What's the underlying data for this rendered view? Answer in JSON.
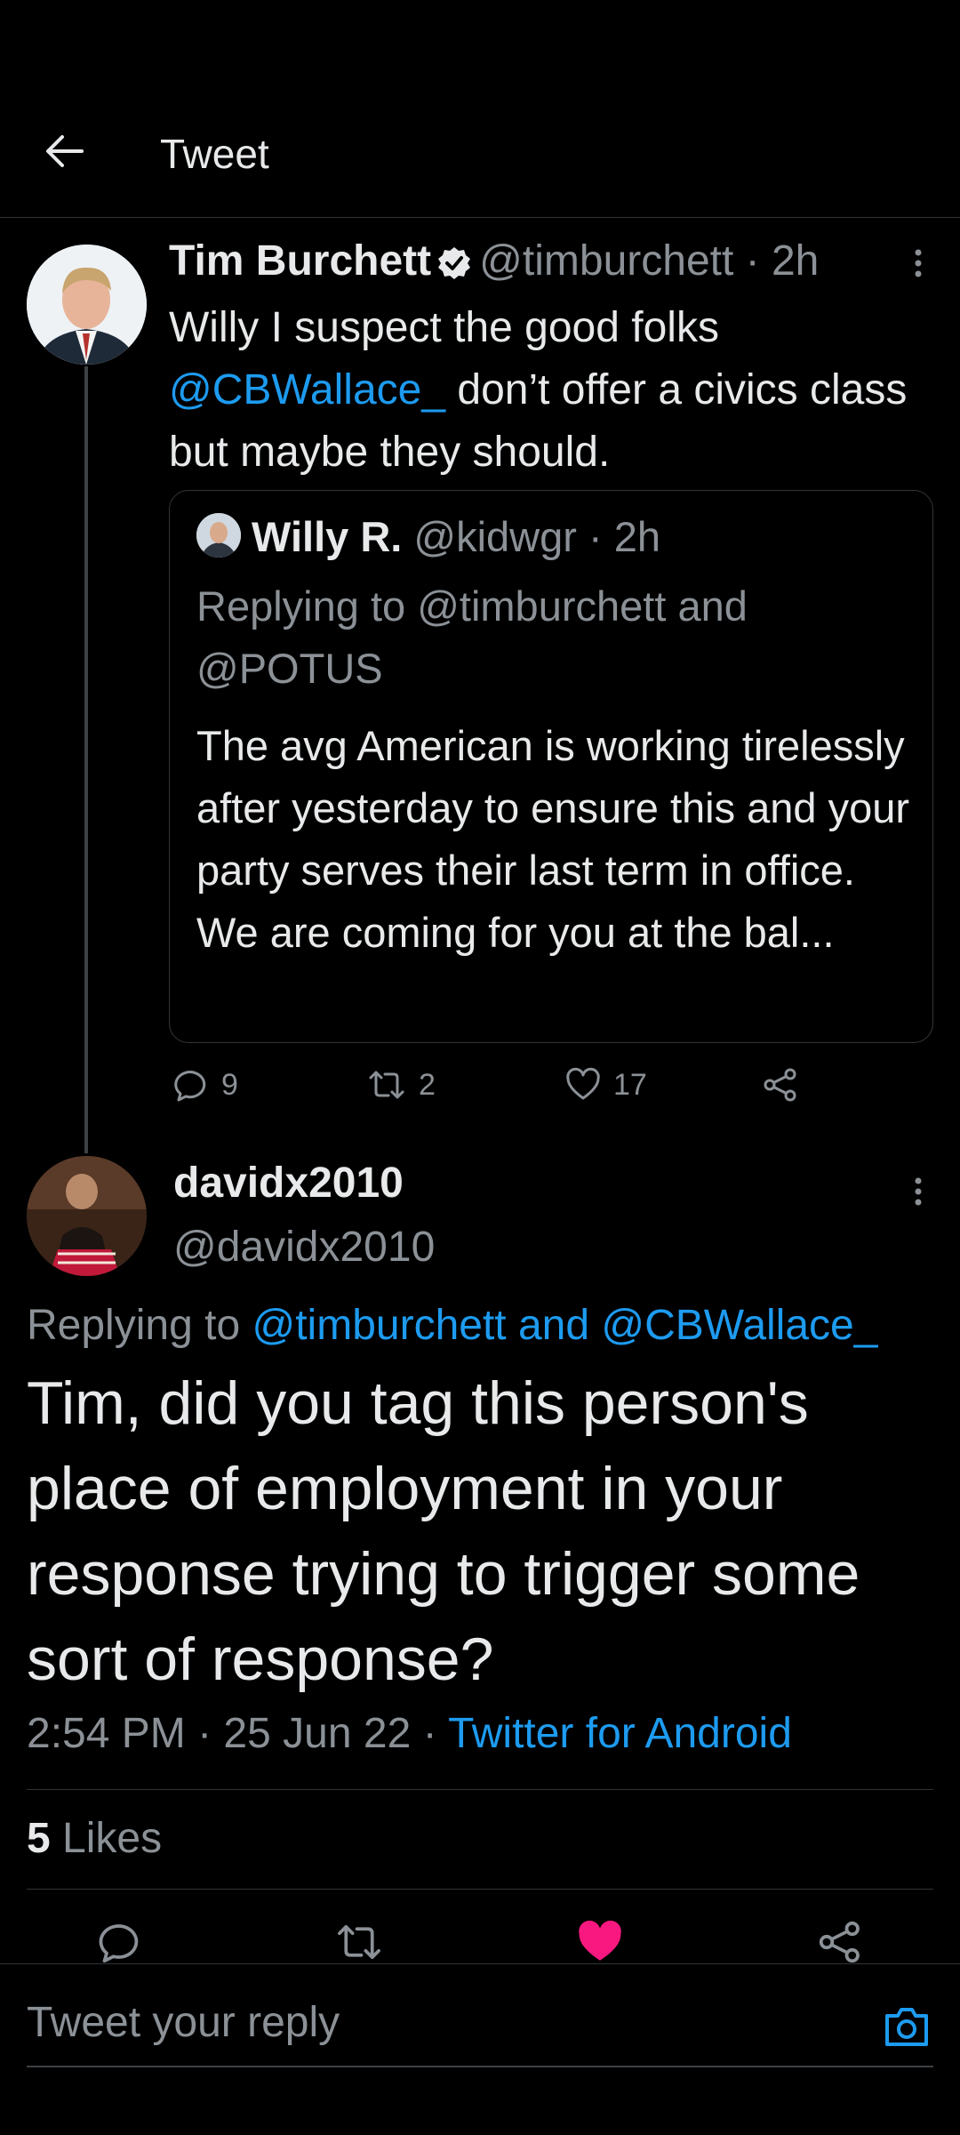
{
  "header": {
    "title": "Tweet"
  },
  "parent_tweet": {
    "name": "Tim Burchett",
    "handle": "@timburchett",
    "time": "· 2h",
    "text_1": "Willy I suspect the good folks",
    "mention": "@CBWallace_",
    "text_2": " don’t offer a civics class but maybe they should.",
    "quote": {
      "name": "Willy R.",
      "handle": "@kidwgr",
      "time": "· 2h",
      "replying": "Replying to @timburchett and @POTUS",
      "text_1": "The avg American is working tirelessly after yesterday to ensure this and your party serves their last term in office.",
      "text_2": "We are coming for you at the bal..."
    },
    "actions": {
      "replies": "9",
      "retweets": "2",
      "likes": "17"
    }
  },
  "reply_tweet": {
    "name": "davidx2010",
    "handle": "@davidx2010",
    "replying_prefix": "Replying to ",
    "replying_targets": "@timburchett and @CBWallace_",
    "text": "Tim, did you tag this person's place of employment in your response trying to trigger some sort of response?",
    "time": "2:54 PM",
    "date": "· 25 Jun 22 ·",
    "source": "Twitter for Android",
    "likes_count": "5",
    "likes_label": " Likes"
  },
  "composer": {
    "placeholder": "Tweet your reply"
  },
  "colors": {
    "accent": "#1d9bf0",
    "like": "#f91880",
    "background": "#000000"
  }
}
